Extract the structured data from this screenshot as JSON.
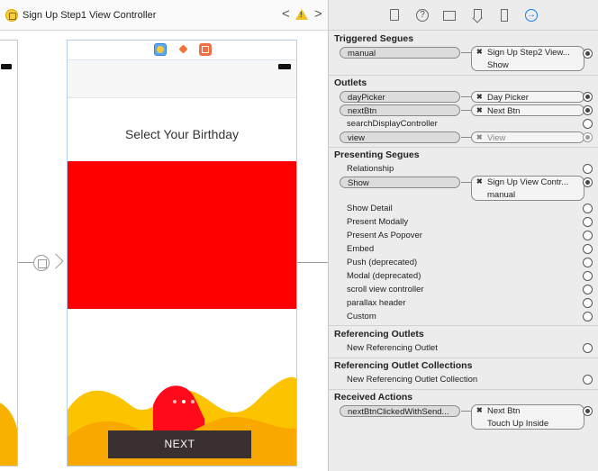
{
  "jumpbar": {
    "title": "Sign Up Step1 View Controller",
    "back": "<",
    "forward": ">",
    "warning": "!"
  },
  "scene": {
    "heading": "Select Your Birthday",
    "next_label": "NEXT",
    "picker_color": "#ff0000",
    "button_color": "#3a3030"
  },
  "inspector": {
    "triggered_segues": {
      "title": "Triggered Segues",
      "rows": [
        {
          "source": "manual",
          "target_line1": "Sign Up Step2 View...",
          "target_line2": "Show"
        }
      ]
    },
    "outlets": {
      "title": "Outlets",
      "rows": [
        {
          "source": "dayPicker",
          "target": "Day Picker",
          "connected": true
        },
        {
          "source": "nextBtn",
          "target": "Next Btn",
          "connected": true
        },
        {
          "source": "searchDisplayController",
          "connected": false
        },
        {
          "source": "view",
          "target": "View",
          "connected": true,
          "dimmed": true
        }
      ]
    },
    "presenting_segues": {
      "title": "Presenting Segues",
      "rows": [
        {
          "source": "Relationship",
          "connected": false
        },
        {
          "source": "Show",
          "target_line1": "Sign Up View Contr...",
          "target_line2": "manual",
          "connected": true
        },
        {
          "source": "Show Detail",
          "connected": false
        },
        {
          "source": "Present Modally",
          "connected": false
        },
        {
          "source": "Present As Popover",
          "connected": false
        },
        {
          "source": "Embed",
          "connected": false
        },
        {
          "source": "Push (deprecated)",
          "connected": false
        },
        {
          "source": "Modal (deprecated)",
          "connected": false
        },
        {
          "source": "scroll view controller",
          "connected": false
        },
        {
          "source": "parallax header",
          "connected": false
        },
        {
          "source": "Custom",
          "connected": false
        }
      ]
    },
    "referencing_outlets": {
      "title": "Referencing Outlets",
      "rows": [
        {
          "source": "New Referencing Outlet"
        }
      ]
    },
    "referencing_outlet_collections": {
      "title": "Referencing Outlet Collections",
      "rows": [
        {
          "source": "New Referencing Outlet Collection"
        }
      ]
    },
    "received_actions": {
      "title": "Received Actions",
      "rows": [
        {
          "source": "nextBtnClickedWithSend...",
          "target_line1": "Next Btn",
          "target_line2": "Touch Up Inside"
        }
      ]
    }
  },
  "colors": {
    "accent": "#1a7cf5",
    "wave_yellow": "#fcc400",
    "wave_orange": "#f9a800",
    "wave_red": "#ff0a1a"
  }
}
